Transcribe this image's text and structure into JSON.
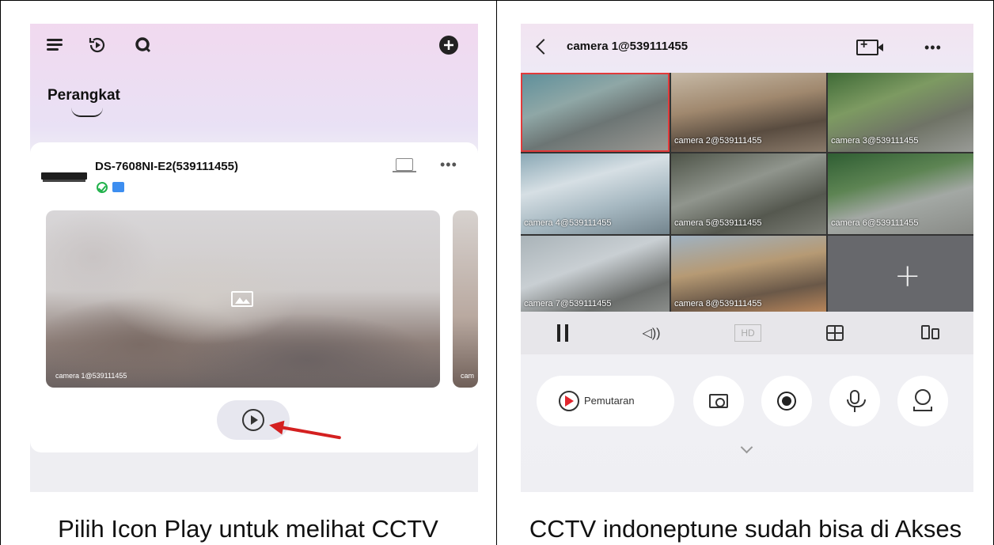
{
  "left_panel": {
    "tab_title": "Perangkat",
    "device": {
      "name": "DS-7608NI-E2(539111455)",
      "status": "online"
    },
    "thumbnails": [
      {
        "label": "camera 1@539111455"
      },
      {
        "label": "cam"
      }
    ],
    "caption": "Pilih Icon Play untuk melihat CCTV"
  },
  "right_panel": {
    "title": "camera 1@539111455",
    "more_label": "•••",
    "cameras": [
      {
        "label": ""
      },
      {
        "label": "camera 2@539111455"
      },
      {
        "label": "camera 3@539111455"
      },
      {
        "label": "camera 4@539111455"
      },
      {
        "label": "camera 5@539111455"
      },
      {
        "label": "camera 6@539111455"
      },
      {
        "label": "camera 7@539111455"
      },
      {
        "label": "camera 8@539111455"
      }
    ],
    "add_cell_symbol": "+",
    "controls": {
      "hd_label": "HD",
      "sound_symbol": "◁))"
    },
    "actions": {
      "playback_label": "Pemutaran"
    },
    "caption": "CCTV indoneptune sudah bisa di Akses"
  },
  "colors": {
    "accent_red": "#d42020",
    "online_green": "#22b24c",
    "cloud_blue": "#3d8ef0"
  },
  "icons": [
    "menu-icon",
    "replay-icon",
    "search-icon",
    "add-icon",
    "nvr-icon",
    "monitor-icon",
    "image-icon",
    "play-icon",
    "back-icon",
    "add-camera-icon",
    "pause-icon",
    "sound-icon",
    "split-screen-icon",
    "rotate-icon",
    "snapshot-icon",
    "record-icon",
    "microphone-icon",
    "ptz-icon",
    "chevron-down-icon"
  ]
}
